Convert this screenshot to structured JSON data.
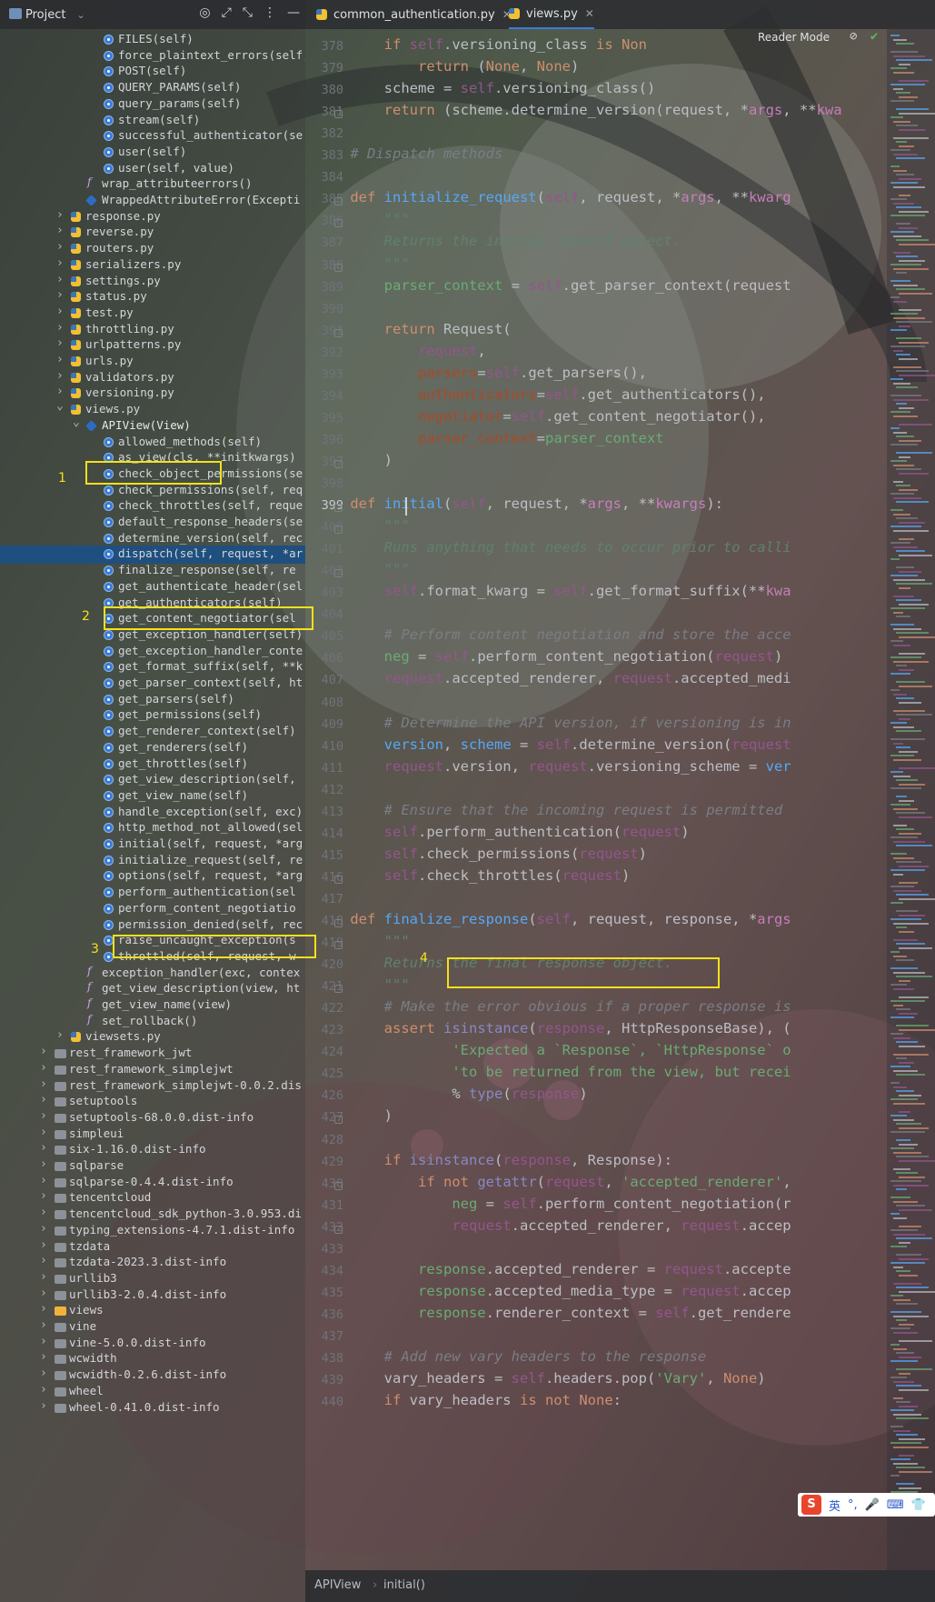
{
  "project_panel": {
    "title": "Project",
    "tree": [
      {
        "label": "FILES(self)",
        "icon": "method-icon"
      },
      {
        "label": "force_plaintext_errors(self,",
        "icon": "method-icon"
      },
      {
        "label": "POST(self)",
        "icon": "method-icon"
      },
      {
        "label": "QUERY_PARAMS(self)",
        "icon": "method-icon"
      },
      {
        "label": "query_params(self)",
        "icon": "method-icon"
      },
      {
        "label": "stream(self)",
        "icon": "method-icon"
      },
      {
        "label": "successful_authenticator(se",
        "icon": "method-icon"
      },
      {
        "label": "user(self)",
        "icon": "method-icon"
      },
      {
        "label": "user(self, value)",
        "icon": "method-icon"
      },
      {
        "label": "wrap_attributeerrors()",
        "icon": "function-icon"
      },
      {
        "label": "WrappedAttributeError(Excepti",
        "icon": "class-icon"
      },
      {
        "label": "response.py",
        "icon": "python-file-icon"
      },
      {
        "label": "reverse.py",
        "icon": "python-file-icon"
      },
      {
        "label": "routers.py",
        "icon": "python-file-icon"
      },
      {
        "label": "serializers.py",
        "icon": "python-file-icon"
      },
      {
        "label": "settings.py",
        "icon": "python-file-icon"
      },
      {
        "label": "status.py",
        "icon": "python-file-icon"
      },
      {
        "label": "test.py",
        "icon": "python-file-icon"
      },
      {
        "label": "throttling.py",
        "icon": "python-file-icon"
      },
      {
        "label": "urlpatterns.py",
        "icon": "python-file-icon"
      },
      {
        "label": "urls.py",
        "icon": "python-file-icon"
      },
      {
        "label": "validators.py",
        "icon": "python-file-icon"
      },
      {
        "label": "versioning.py",
        "icon": "python-file-icon"
      },
      {
        "label": "views.py",
        "icon": "python-file-icon"
      },
      {
        "label": "APIView(View)",
        "icon": "class-icon"
      },
      {
        "label": "allowed_methods(self)",
        "icon": "method-icon"
      },
      {
        "label": "as_view(cls, **initkwargs)",
        "icon": "method-icon"
      },
      {
        "label": "check_object_permissions(se",
        "icon": "method-icon"
      },
      {
        "label": "check_permissions(self, req",
        "icon": "method-icon"
      },
      {
        "label": "check_throttles(self, reque",
        "icon": "method-icon"
      },
      {
        "label": "default_response_headers(se",
        "icon": "method-icon"
      },
      {
        "label": "determine_version(self, rec",
        "icon": "method-icon"
      },
      {
        "label": "dispatch(self, request, *ar",
        "icon": "method-icon"
      },
      {
        "label": "finalize_response(self, re",
        "icon": "method-icon"
      },
      {
        "label": "get_authenticate_header(sel",
        "icon": "method-icon"
      },
      {
        "label": "get_authenticators(self)",
        "icon": "method-icon"
      },
      {
        "label": "get_content_negotiator(sel",
        "icon": "method-icon"
      },
      {
        "label": "get_exception_handler(self)",
        "icon": "method-icon"
      },
      {
        "label": "get_exception_handler_conte",
        "icon": "method-icon"
      },
      {
        "label": "get_format_suffix(self, **k",
        "icon": "method-icon"
      },
      {
        "label": "get_parser_context(self, ht",
        "icon": "method-icon"
      },
      {
        "label": "get_parsers(self)",
        "icon": "method-icon"
      },
      {
        "label": "get_permissions(self)",
        "icon": "method-icon"
      },
      {
        "label": "get_renderer_context(self)",
        "icon": "method-icon"
      },
      {
        "label": "get_renderers(self)",
        "icon": "method-icon"
      },
      {
        "label": "get_throttles(self)",
        "icon": "method-icon"
      },
      {
        "label": "get_view_description(self,",
        "icon": "method-icon"
      },
      {
        "label": "get_view_name(self)",
        "icon": "method-icon"
      },
      {
        "label": "handle_exception(self, exc)",
        "icon": "method-icon"
      },
      {
        "label": "http_method_not_allowed(sel",
        "icon": "method-icon"
      },
      {
        "label": "initial(self, request, *arg",
        "icon": "method-icon"
      },
      {
        "label": "initialize_request(self, re",
        "icon": "method-icon"
      },
      {
        "label": "options(self, request, *arg",
        "icon": "method-icon"
      },
      {
        "label": "perform_authentication(sel",
        "icon": "method-icon"
      },
      {
        "label": "perform_content_negotiatio",
        "icon": "method-icon"
      },
      {
        "label": "permission_denied(self, rec",
        "icon": "method-icon"
      },
      {
        "label": "raise_uncaught_exception(s",
        "icon": "method-icon"
      },
      {
        "label": "throttled(self, request, w",
        "icon": "method-icon"
      },
      {
        "label": "exception_handler(exc, contex",
        "icon": "function-icon"
      },
      {
        "label": "get_view_description(view, ht",
        "icon": "function-icon"
      },
      {
        "label": "get_view_name(view)",
        "icon": "function-icon"
      },
      {
        "label": "set_rollback()",
        "icon": "function-icon"
      },
      {
        "label": "viewsets.py",
        "icon": "python-file-icon"
      },
      {
        "label": "rest_framework_jwt",
        "icon": "folder-icon"
      },
      {
        "label": "rest_framework_simplejwt",
        "icon": "folder-icon"
      },
      {
        "label": "rest_framework_simplejwt-0.0.2.dis",
        "icon": "folder-icon"
      },
      {
        "label": "setuptools",
        "icon": "folder-icon"
      },
      {
        "label": "setuptools-68.0.0.dist-info",
        "icon": "folder-icon"
      },
      {
        "label": "simpleui",
        "icon": "folder-icon"
      },
      {
        "label": "six-1.16.0.dist-info",
        "icon": "folder-icon"
      },
      {
        "label": "sqlparse",
        "icon": "folder-icon"
      },
      {
        "label": "sqlparse-0.4.4.dist-info",
        "icon": "folder-icon"
      },
      {
        "label": "tencentcloud",
        "icon": "folder-icon"
      },
      {
        "label": "tencentcloud_sdk_python-3.0.953.di",
        "icon": "folder-icon"
      },
      {
        "label": "typing_extensions-4.7.1.dist-info",
        "icon": "folder-icon"
      },
      {
        "label": "tzdata",
        "icon": "folder-icon"
      },
      {
        "label": "tzdata-2023.3.dist-info",
        "icon": "folder-icon"
      },
      {
        "label": "urllib3",
        "icon": "folder-icon"
      },
      {
        "label": "urllib3-2.0.4.dist-info",
        "icon": "folder-icon"
      },
      {
        "label": "views",
        "icon": "folder-icon"
      },
      {
        "label": "vine",
        "icon": "folder-icon"
      },
      {
        "label": "vine-5.0.0.dist-info",
        "icon": "folder-icon"
      },
      {
        "label": "wcwidth",
        "icon": "folder-icon"
      },
      {
        "label": "wcwidth-0.2.6.dist-info",
        "icon": "folder-icon"
      },
      {
        "label": "wheel",
        "icon": "folder-icon"
      },
      {
        "label": "wheel-0.41.0.dist-info",
        "icon": "folder-icon"
      }
    ],
    "annotations": [
      "1",
      "2",
      "3",
      "4"
    ]
  },
  "tabs": [
    {
      "label": "common_authentication.py",
      "active": false
    },
    {
      "label": "views.py",
      "active": true
    }
  ],
  "editor": {
    "reader_mode": "Reader Mode",
    "current_line": "399",
    "line_numbers": [
      "378",
      "379",
      "380",
      "381",
      "382",
      "383",
      "384",
      "385",
      "386",
      "387",
      "388",
      "389",
      "390",
      "391",
      "392",
      "393",
      "394",
      "395",
      "396",
      "397",
      "398",
      "399",
      "400",
      "401",
      "402",
      "403",
      "404",
      "405",
      "406",
      "407",
      "408",
      "409",
      "410",
      "411",
      "412",
      "413",
      "414",
      "415",
      "416",
      "417",
      "418",
      "419",
      "420",
      "421",
      "422",
      "423",
      "424",
      "425",
      "426",
      "427",
      "428",
      "429",
      "430",
      "431",
      "432",
      "433",
      "434",
      "435",
      "436",
      "437",
      "438",
      "439",
      "440"
    ]
  },
  "status_bar": {
    "breadcrumb": [
      "APIView",
      "initial()"
    ]
  },
  "ime": {
    "label": "英"
  },
  "colors": {
    "accent": "#3d7bd9",
    "highlight": "#f5e11a",
    "selection": "#1f4f7e"
  }
}
